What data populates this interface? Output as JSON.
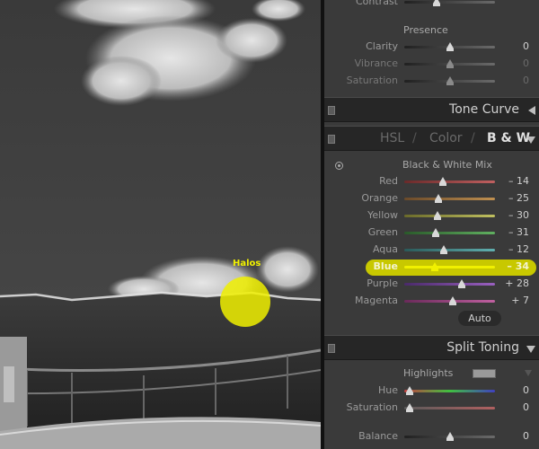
{
  "photo": {
    "annotation_label": "Halos",
    "highlight_color": "#ffff00"
  },
  "panel": {
    "top_partial_label": "Contrast",
    "presence": {
      "title": "Presence",
      "sliders": [
        {
          "label": "Clarity",
          "value": "0",
          "level": 0.5
        },
        {
          "label": "Vibrance",
          "value": "0",
          "level": 0.5
        },
        {
          "label": "Saturation",
          "value": "0",
          "level": 0.5
        }
      ]
    },
    "tone_curve": {
      "title": "Tone Curve"
    },
    "color_tabs": {
      "hsl": "HSL",
      "color": "Color",
      "bw": "B & W",
      "separator": "/"
    },
    "bw_mix": {
      "title": "Black & White Mix",
      "sliders": [
        {
          "label": "Red",
          "value": "– 14",
          "level": 0.43,
          "gradient": [
            "#6a2a2a",
            "#c06060"
          ]
        },
        {
          "label": "Orange",
          "value": "– 25",
          "level": 0.38,
          "gradient": [
            "#6a4a2a",
            "#c09050"
          ]
        },
        {
          "label": "Yellow",
          "value": "– 30",
          "level": 0.37,
          "gradient": [
            "#6a6a2a",
            "#c0c060"
          ]
        },
        {
          "label": "Green",
          "value": "– 31",
          "level": 0.35,
          "gradient": [
            "#2a5a2a",
            "#60b060"
          ]
        },
        {
          "label": "Aqua",
          "value": "– 12",
          "level": 0.44,
          "gradient": [
            "#2a5a5a",
            "#60b0b0"
          ]
        },
        {
          "label": "Blue",
          "value": "– 34",
          "level": 0.34,
          "gradient": [
            "#f0f000",
            "#f0f000"
          ],
          "highlighted": true
        },
        {
          "label": "Purple",
          "value": "+ 28",
          "level": 0.63,
          "gradient": [
            "#4a2a6a",
            "#9a60c0"
          ]
        },
        {
          "label": "Magenta",
          "value": "+ 7",
          "level": 0.53,
          "gradient": [
            "#6a2a5a",
            "#c060a0"
          ]
        }
      ],
      "auto_label": "Auto"
    },
    "split_toning": {
      "title": "Split Toning",
      "highlights_label": "Highlights",
      "sliders": [
        {
          "label": "Hue",
          "value": "0",
          "level": 0.06,
          "gradient": [
            "#c04040",
            "#40c040",
            "#4040c0"
          ]
        },
        {
          "label": "Saturation",
          "value": "0",
          "level": 0.06,
          "gradient": [
            "#5a5a5a",
            "#b06060"
          ]
        }
      ],
      "balance": {
        "label": "Balance",
        "value": "0",
        "level": 0.5
      }
    }
  }
}
